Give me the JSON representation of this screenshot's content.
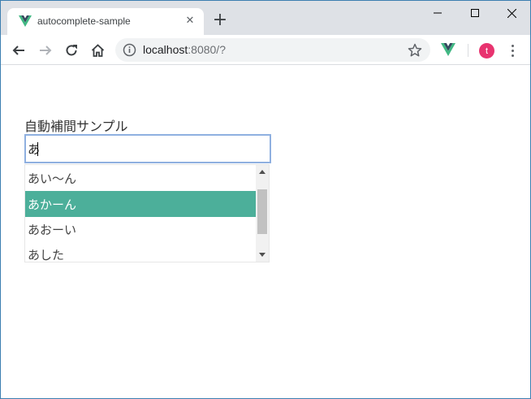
{
  "browser": {
    "tab": {
      "title": "autocomplete-sample",
      "favicon": "vue-logo-icon",
      "close_glyph": "✕"
    },
    "new_tab_glyph": "+",
    "url": {
      "host": "localhost",
      "rest": ":8080/?"
    },
    "profile_initial": "t",
    "colors": {
      "vue_green": "#41b883",
      "vue_dark": "#35495e",
      "avatar": "#e8336f"
    }
  },
  "page": {
    "title": "自動補間サンプル",
    "input": {
      "value": "あ"
    },
    "suggestions": [
      {
        "label": "あい〜ん",
        "selected": false
      },
      {
        "label": "あかーん",
        "selected": true
      },
      {
        "label": "あおーい",
        "selected": false
      },
      {
        "label": "あした",
        "selected": false
      }
    ],
    "colors": {
      "selected_bg": "#4caf9a",
      "input_border": "#8fb0e0"
    }
  }
}
